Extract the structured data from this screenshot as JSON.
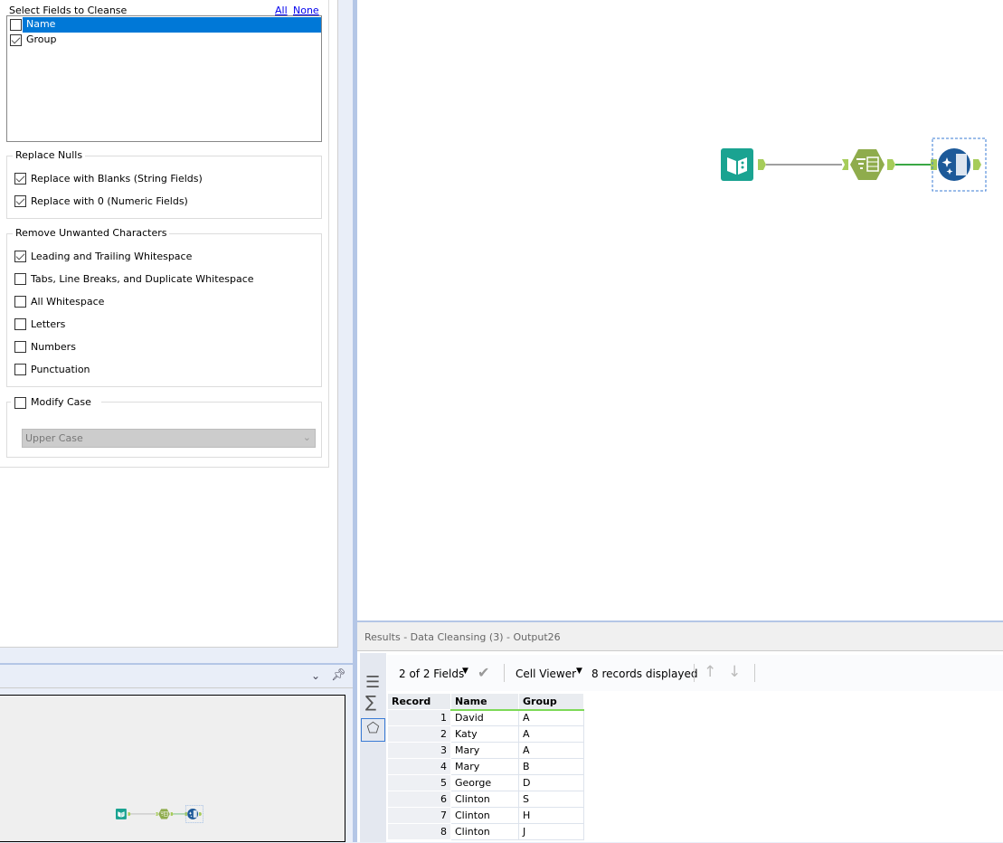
{
  "config": {
    "fields_title": "Select Fields to Cleanse",
    "all_link": "All",
    "none_link": "None",
    "fields": [
      {
        "label": "Name",
        "checked": false,
        "selected": true
      },
      {
        "label": "Group",
        "checked": true,
        "selected": false
      }
    ],
    "replace_nulls": {
      "title": "Replace Nulls",
      "options": [
        {
          "label": "Replace with Blanks (String Fields)",
          "checked": true
        },
        {
          "label": "Replace with 0 (Numeric Fields)",
          "checked": true
        }
      ]
    },
    "remove_chars": {
      "title": "Remove Unwanted Characters",
      "options": [
        {
          "label": "Leading and Trailing Whitespace",
          "checked": true
        },
        {
          "label": "Tabs, Line Breaks, and Duplicate Whitespace",
          "checked": false
        },
        {
          "label": "All Whitespace",
          "checked": false
        },
        {
          "label": "Letters",
          "checked": false
        },
        {
          "label": "Numbers",
          "checked": false
        },
        {
          "label": "Punctuation",
          "checked": false
        }
      ]
    },
    "modify_case": {
      "label": "Modify Case",
      "checked": false,
      "select_value": "Upper Case"
    }
  },
  "results": {
    "title": "Results - Data Cleansing (3) - Output26",
    "fields_label": "2 of 2 Fields",
    "viewer_label": "Cell Viewer",
    "records_label": "8 records displayed",
    "columns": [
      "Record",
      "Name",
      "Group"
    ],
    "rows": [
      [
        "1",
        "David",
        "A"
      ],
      [
        "2",
        "Katy",
        "A"
      ],
      [
        "3",
        "Mary",
        "A"
      ],
      [
        "4",
        "Mary",
        "B"
      ],
      [
        "5",
        "George",
        "D"
      ],
      [
        "6",
        "Clinton",
        "S"
      ],
      [
        "7",
        "Clinton",
        "H"
      ],
      [
        "8",
        "Clinton",
        "J"
      ]
    ]
  },
  "colors": {
    "selection": "#0078d7",
    "input_tool": "#1aa391",
    "select_tool": "#8fac4c",
    "cleanse_tool": "#1d5a99",
    "connection_active": "#3aa845"
  }
}
